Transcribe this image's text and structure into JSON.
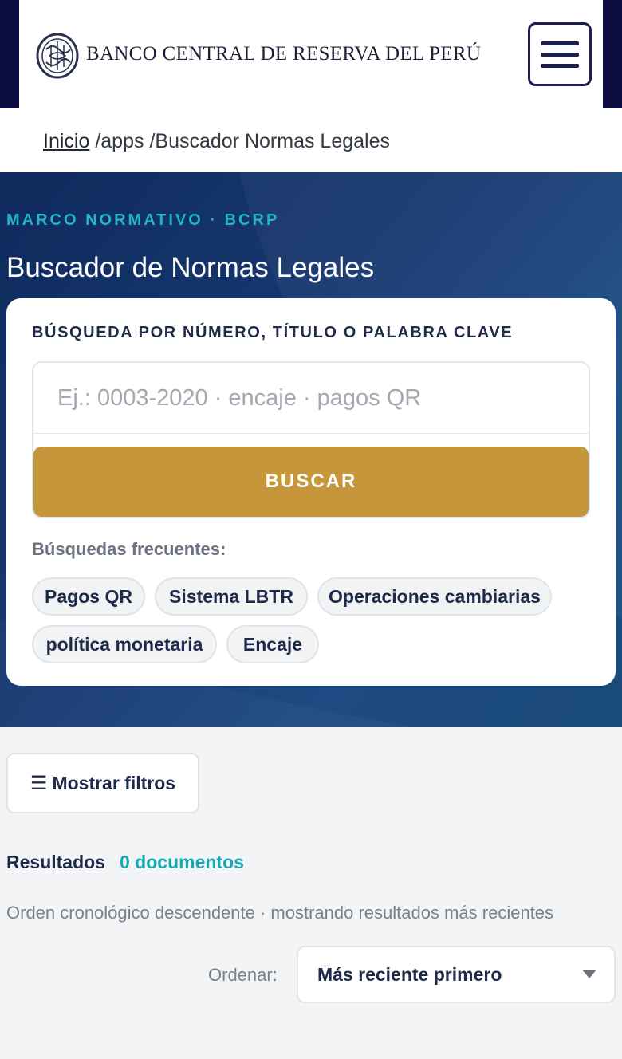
{
  "header": {
    "logo_text": "BANCO CENTRAL DE RESERVA DEL PERÚ",
    "logo_icon": "bcrp-seal-icon",
    "menu_icon": "hamburger-menu-icon"
  },
  "breadcrumb": {
    "home": "Inicio",
    "sep1": " /",
    "apps": "apps",
    "sep2": " /",
    "current": "Buscador Normas Legales"
  },
  "hero": {
    "kicker": "MARCO NORMATIVO · BCRP",
    "title": "Buscador de Normas Legales"
  },
  "search": {
    "label": "BÚSQUEDA POR NÚMERO, TÍTULO O PALABRA CLAVE",
    "placeholder": "Ej.: 0003-2020 · encaje · pagos QR",
    "value": "",
    "button": "BUSCAR",
    "frequent_label": "Búsquedas frecuentes:",
    "chips": [
      "Pagos QR",
      "Sistema LBTR",
      "Operaciones cambiarias",
      "política monetaria",
      "Encaje"
    ]
  },
  "filters": {
    "toggle_label": "Mostrar filtros",
    "toggle_icon": "list-icon"
  },
  "results": {
    "label": "Resultados",
    "count": "0 documentos",
    "order_note": "Orden cronológico descendente · mostrando resultados más recientes",
    "sort_label": "Ordenar:",
    "sort_value": "Más reciente primero",
    "sort_icon": "caret-down-icon"
  },
  "colors": {
    "header_dark": "#0c0c40",
    "accent_gold": "#c6963a",
    "accent_teal": "#18a9b8",
    "navy_text": "#1f2a4a"
  }
}
